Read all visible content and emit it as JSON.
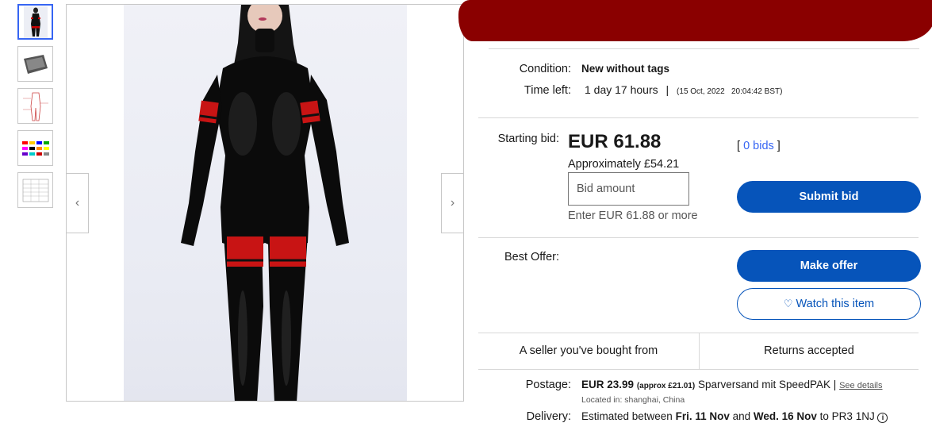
{
  "gallery": {
    "thumbnails": [
      "thumbnail-1",
      "thumbnail-2",
      "thumbnail-3",
      "thumbnail-4",
      "thumbnail-5"
    ],
    "prev_icon": "chevron-left-icon",
    "next_icon": "chevron-right-icon"
  },
  "item": {
    "condition_label": "Condition:",
    "condition_value": "New without tags",
    "time_left_label": "Time left:",
    "time_left_value": "1 day 17 hours",
    "time_sep": "|",
    "end_time": "(15 Oct, 2022   20:04:42 BST)"
  },
  "bid": {
    "label": "Starting bid:",
    "price": "EUR 61.88",
    "bids_open": "[",
    "bids_link": "0 bids",
    "bids_close": "]",
    "approx": "Approximately £54.21",
    "input_placeholder": "Bid amount",
    "hint": "Enter EUR 61.88 or more",
    "submit_label": "Submit bid"
  },
  "offer": {
    "label": "Best Offer:",
    "make_offer_label": "Make offer",
    "watch_label": "Watch this item",
    "watch_icon": "heart-icon"
  },
  "highlights": {
    "seller": "A seller you've bought from",
    "returns": "Returns accepted"
  },
  "postage": {
    "label": "Postage:",
    "price": "EUR 23.99",
    "approx": "(approx £21.01)",
    "service": "Sparversand mit SpeedPAK |",
    "details_link": "See details",
    "location": "Located in: shanghai, China"
  },
  "delivery": {
    "label": "Delivery:",
    "text_start": "Estimated between ",
    "date1": "Fri. 11 Nov",
    "and": " and ",
    "date2": "Wed. 16 Nov",
    "to": " to PR3 1NJ",
    "info_icon": "info-icon"
  },
  "colors": {
    "primary_button": "#0654ba",
    "link": "#3665f3",
    "redaction": "#8a0000"
  }
}
